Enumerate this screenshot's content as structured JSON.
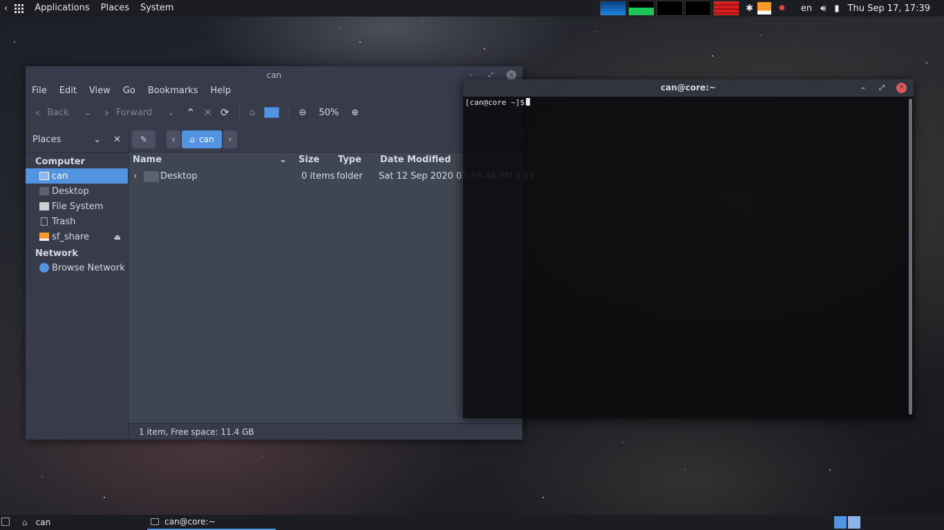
{
  "top_panel": {
    "menus": [
      "Applications",
      "Places",
      "System"
    ],
    "tray": {
      "language": "en",
      "clock": "Thu Sep 17, 17:39"
    },
    "colors": {
      "cpu": "#1e88e5",
      "mem": "#1fc75a",
      "net": "#000000",
      "load": "#d62020"
    }
  },
  "file_manager": {
    "title": "can",
    "menu": [
      "File",
      "Edit",
      "View",
      "Go",
      "Bookmarks",
      "Help"
    ],
    "toolbar": {
      "back": "Back",
      "forward": "Forward",
      "zoom": "50%"
    },
    "sidebar": {
      "header": "Places",
      "sections": [
        {
          "title": "Computer",
          "items": [
            {
              "label": "can",
              "icon": "home-icon",
              "active": true
            },
            {
              "label": "Desktop",
              "icon": "desktop-icon"
            },
            {
              "label": "File System",
              "icon": "drive-icon"
            },
            {
              "label": "Trash",
              "icon": "trash-icon"
            },
            {
              "label": "sf_share",
              "icon": "drive-icon"
            }
          ]
        },
        {
          "title": "Network",
          "items": [
            {
              "label": "Browse Network",
              "icon": "network-icon"
            }
          ]
        }
      ]
    },
    "path": {
      "current": "can"
    },
    "columns": {
      "name": "Name",
      "size": "Size",
      "type": "Type",
      "modified": "Date Modified"
    },
    "rows": [
      {
        "name": "Desktop",
        "size": "0 items",
        "type": "folder",
        "modified": "Sat 12 Sep 2020 07:59:46 PM +03"
      }
    ],
    "status": "1 item, Free space: 11.4 GB"
  },
  "terminal": {
    "title": "can@core:~",
    "prompt": "[can@core ~]$"
  },
  "bottom_panel": {
    "tasks": [
      "can",
      "can@core:~"
    ]
  }
}
